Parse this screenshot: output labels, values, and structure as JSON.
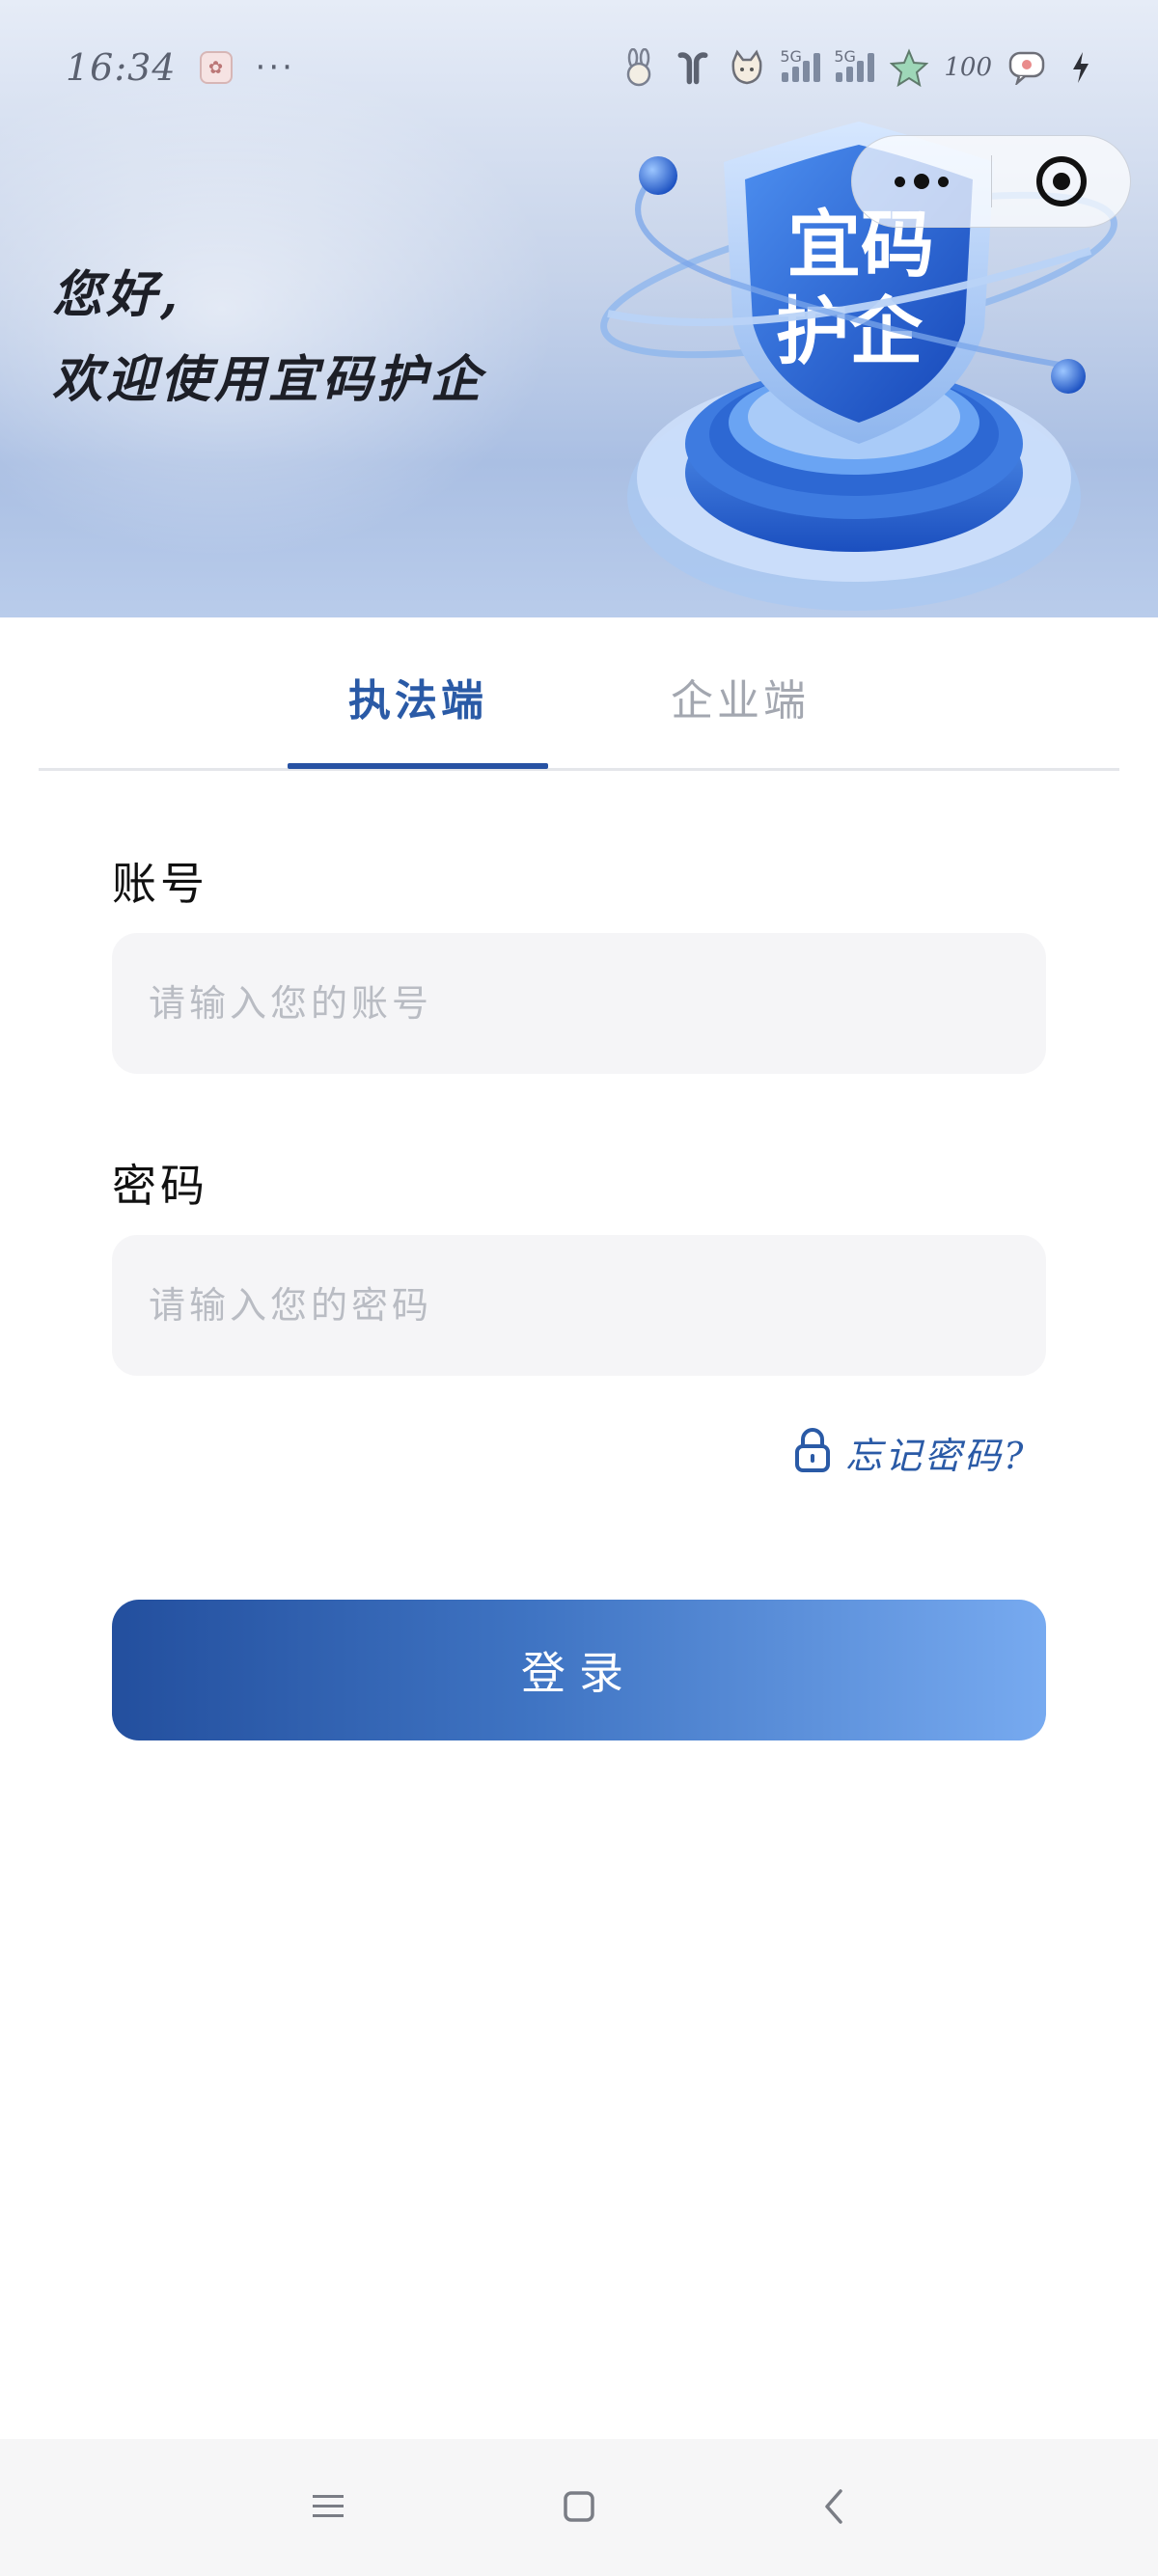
{
  "status_bar": {
    "time": "16:34",
    "overflow": "···",
    "battery": "100",
    "network_tag_1": "5G",
    "network_tag_2": "5G",
    "icons": [
      "app-notification-icon",
      "bunny-icon",
      "earbuds-icon",
      "cat-icon",
      "signal-icon",
      "signal-icon",
      "star-icon",
      "message-icon",
      "charging-icon"
    ]
  },
  "capsule": {
    "more_icon": "more-dots-icon",
    "close_icon": "target-close-icon"
  },
  "hero": {
    "greeting_line1": "您好,",
    "greeting_line2": "欢迎使用宜码护企",
    "shield_line1": "宜码",
    "shield_line2": "护企"
  },
  "tabs": [
    {
      "label": "执法端",
      "active": true
    },
    {
      "label": "企业端",
      "active": false
    }
  ],
  "form": {
    "account_label": "账号",
    "account_placeholder": "请输入您的账号",
    "account_value": "",
    "password_label": "密码",
    "password_placeholder": "请输入您的密码",
    "password_value": "",
    "forgot_label": "忘记密码?",
    "login_label": "登录"
  },
  "nav": {
    "menu_icon": "menu-icon",
    "home_icon": "home-icon",
    "back_icon": "back-icon"
  },
  "colors": {
    "accent": "#2a5aa6",
    "button_start": "#234f9e",
    "button_end": "#77aaf0",
    "input_bg": "#f5f5f7"
  }
}
